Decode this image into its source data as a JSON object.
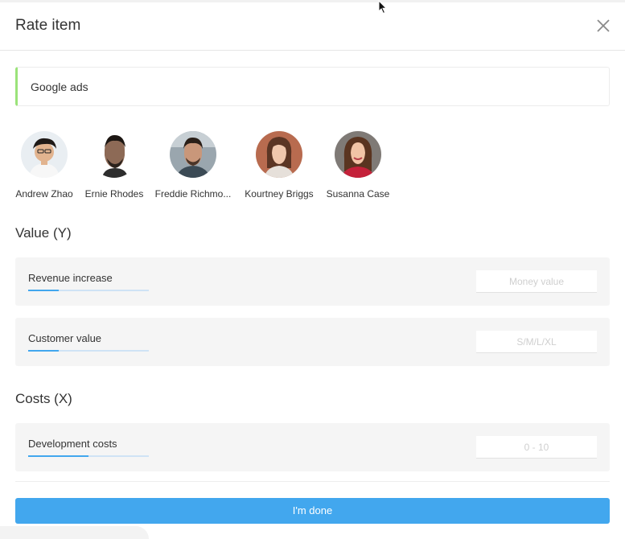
{
  "dialog": {
    "title": "Rate item",
    "close_icon": "close-icon"
  },
  "item": {
    "name": "Google ads",
    "accent_color": "#9be37a"
  },
  "people": [
    {
      "name": "Andrew Zhao"
    },
    {
      "name": "Ernie Rhodes"
    },
    {
      "name": "Freddie Richmo..."
    },
    {
      "name": "Kourtney Briggs"
    },
    {
      "name": "Susanna Case"
    }
  ],
  "value_section": {
    "title": "Value (Y)",
    "criteria": [
      {
        "label": "Revenue increase",
        "placeholder": "Money value",
        "value": "",
        "progress": 0.25
      },
      {
        "label": "Customer value",
        "placeholder": "S/M/L/XL",
        "value": "",
        "progress": 0.25
      }
    ]
  },
  "costs_section": {
    "title": "Costs (X)",
    "criteria": [
      {
        "label": "Development costs",
        "placeholder": "0 - 10",
        "value": "",
        "progress": 0.5
      }
    ]
  },
  "footer": {
    "done_label": "I'm done",
    "button_color": "#42a7ee"
  }
}
